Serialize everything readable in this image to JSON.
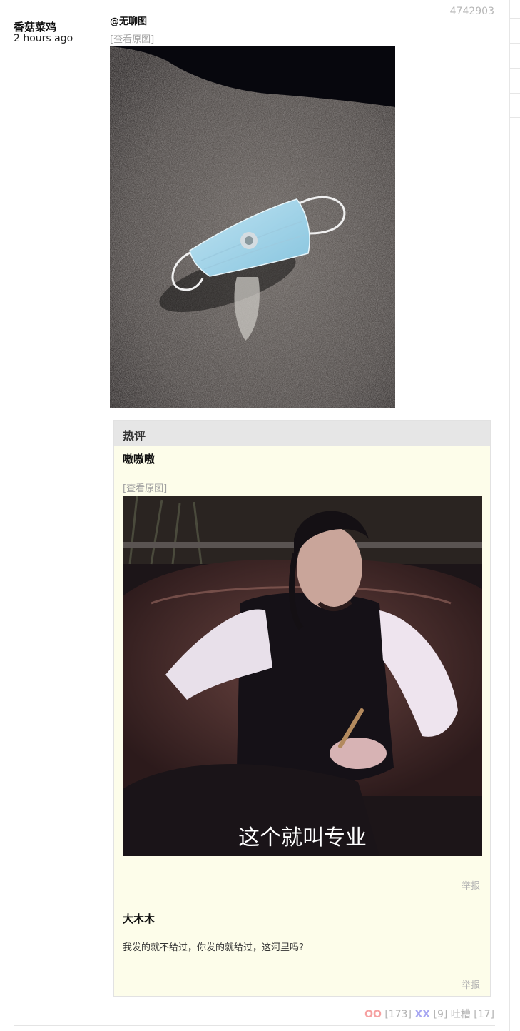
{
  "post": {
    "id": "4742903",
    "author": "香菇菜鸡",
    "time": "2 hours ago",
    "mention": "@无聊图",
    "view_original": "[查看原图]",
    "image_icon": "photo-face-mask-on-asphalt"
  },
  "hot": {
    "title": "热评",
    "comments": [
      {
        "author": "嗷嗷嗷",
        "view_original": "[查看原图]",
        "image_icon": "photo-man-in-leather-chair",
        "image_caption": "这个就叫专业",
        "report": "举报"
      },
      {
        "author": "大木木",
        "text": "我发的就不给过，你发的就给过，这河里吗?",
        "report": "举报"
      }
    ]
  },
  "votes": {
    "oo_label": "OO",
    "oo_count": "[173]",
    "xx_label": "XX",
    "xx_count": "[9]",
    "tucao_label": "吐槽",
    "tucao_count": "[17]"
  },
  "colors": {
    "oo": "#f6a1a1",
    "xx": "#a8a8f2",
    "hot_bg": "#fdfdea",
    "hot_header": "#e6e6e6"
  }
}
